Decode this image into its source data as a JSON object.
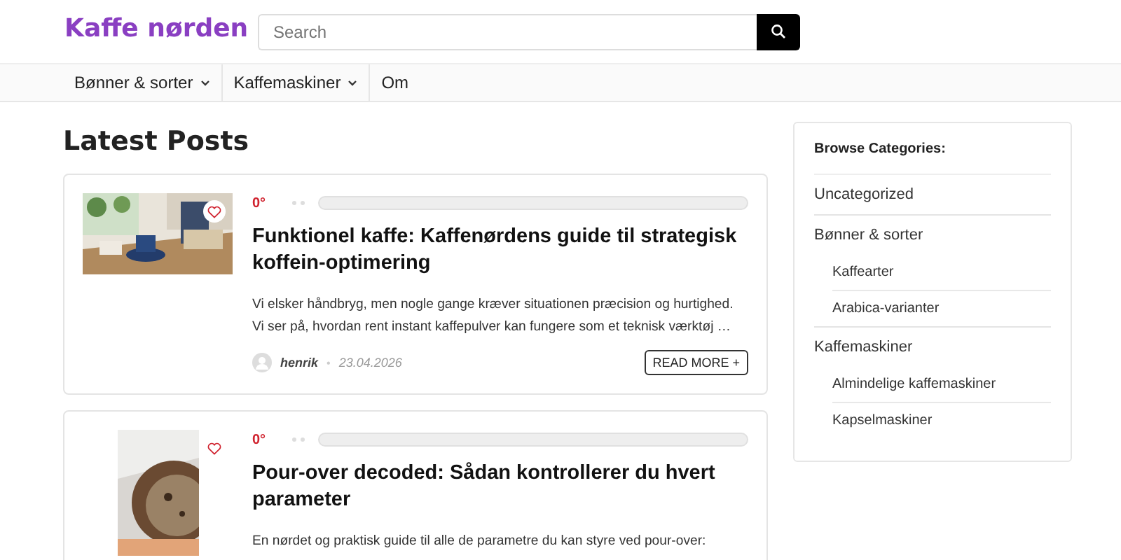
{
  "site": {
    "title": "Kaffe nørden"
  },
  "search": {
    "placeholder": "Search"
  },
  "nav": [
    {
      "label": "Bønner & sorter",
      "dropdown": true
    },
    {
      "label": "Kaffemaskiner",
      "dropdown": true
    },
    {
      "label": "Om",
      "dropdown": false
    }
  ],
  "heading": "Latest Posts",
  "posts": [
    {
      "rating": "0°",
      "level": 0,
      "title": "Funktionel kaffe: Kaffenørdens guide til strategisk koffein-optimering",
      "excerpt": "Vi elsker håndbryg, men nogle gange kræver situationen præcision og hurtighed. Vi ser på, hvordan rent instant kaffepulver kan fungere som et teknisk værktøj …",
      "author": "henrik",
      "separator": "•",
      "date": "23.04.2026",
      "button": "READ MORE +"
    },
    {
      "rating": "0°",
      "level": 0,
      "title": "Pour-over decoded: Sådan kontrollerer du hvert parameter",
      "excerpt": "En nørdet og praktisk guide til alle de parametre du kan styre ved pour-over:"
    }
  ],
  "sidebar": {
    "title": "Browse Categories:",
    "categories": [
      {
        "label": "Uncategorized"
      },
      {
        "label": "Bønner & sorter",
        "children": [
          {
            "label": "Kaffearter"
          },
          {
            "label": "Arabica-varianter"
          }
        ]
      },
      {
        "label": "Kaffemaskiner",
        "children": [
          {
            "label": "Almindelige kaffemaskiner"
          },
          {
            "label": "Kapselmaskiner"
          }
        ]
      }
    ]
  }
}
